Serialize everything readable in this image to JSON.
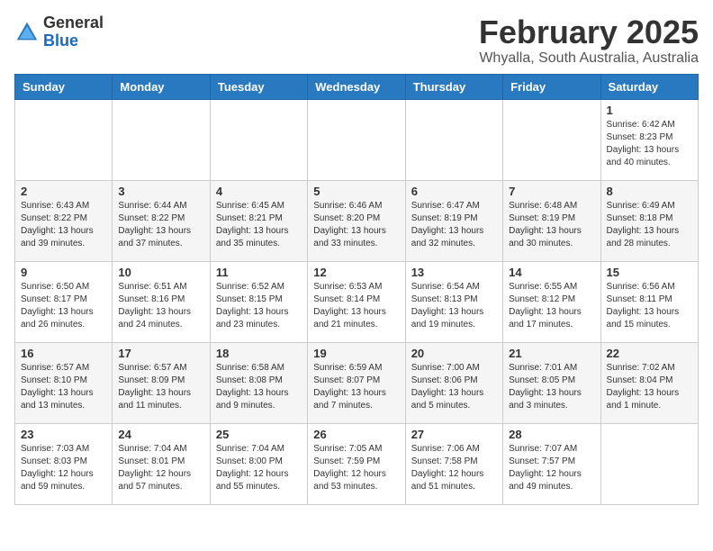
{
  "header": {
    "logo_general": "General",
    "logo_blue": "Blue",
    "month_title": "February 2025",
    "location": "Whyalla, South Australia, Australia"
  },
  "weekdays": [
    "Sunday",
    "Monday",
    "Tuesday",
    "Wednesday",
    "Thursday",
    "Friday",
    "Saturday"
  ],
  "weeks": [
    [
      {
        "day": "",
        "info": ""
      },
      {
        "day": "",
        "info": ""
      },
      {
        "day": "",
        "info": ""
      },
      {
        "day": "",
        "info": ""
      },
      {
        "day": "",
        "info": ""
      },
      {
        "day": "",
        "info": ""
      },
      {
        "day": "1",
        "info": "Sunrise: 6:42 AM\nSunset: 8:23 PM\nDaylight: 13 hours\nand 40 minutes."
      }
    ],
    [
      {
        "day": "2",
        "info": "Sunrise: 6:43 AM\nSunset: 8:22 PM\nDaylight: 13 hours\nand 39 minutes."
      },
      {
        "day": "3",
        "info": "Sunrise: 6:44 AM\nSunset: 8:22 PM\nDaylight: 13 hours\nand 37 minutes."
      },
      {
        "day": "4",
        "info": "Sunrise: 6:45 AM\nSunset: 8:21 PM\nDaylight: 13 hours\nand 35 minutes."
      },
      {
        "day": "5",
        "info": "Sunrise: 6:46 AM\nSunset: 8:20 PM\nDaylight: 13 hours\nand 33 minutes."
      },
      {
        "day": "6",
        "info": "Sunrise: 6:47 AM\nSunset: 8:19 PM\nDaylight: 13 hours\nand 32 minutes."
      },
      {
        "day": "7",
        "info": "Sunrise: 6:48 AM\nSunset: 8:19 PM\nDaylight: 13 hours\nand 30 minutes."
      },
      {
        "day": "8",
        "info": "Sunrise: 6:49 AM\nSunset: 8:18 PM\nDaylight: 13 hours\nand 28 minutes."
      }
    ],
    [
      {
        "day": "9",
        "info": "Sunrise: 6:50 AM\nSunset: 8:17 PM\nDaylight: 13 hours\nand 26 minutes."
      },
      {
        "day": "10",
        "info": "Sunrise: 6:51 AM\nSunset: 8:16 PM\nDaylight: 13 hours\nand 24 minutes."
      },
      {
        "day": "11",
        "info": "Sunrise: 6:52 AM\nSunset: 8:15 PM\nDaylight: 13 hours\nand 23 minutes."
      },
      {
        "day": "12",
        "info": "Sunrise: 6:53 AM\nSunset: 8:14 PM\nDaylight: 13 hours\nand 21 minutes."
      },
      {
        "day": "13",
        "info": "Sunrise: 6:54 AM\nSunset: 8:13 PM\nDaylight: 13 hours\nand 19 minutes."
      },
      {
        "day": "14",
        "info": "Sunrise: 6:55 AM\nSunset: 8:12 PM\nDaylight: 13 hours\nand 17 minutes."
      },
      {
        "day": "15",
        "info": "Sunrise: 6:56 AM\nSunset: 8:11 PM\nDaylight: 13 hours\nand 15 minutes."
      }
    ],
    [
      {
        "day": "16",
        "info": "Sunrise: 6:57 AM\nSunset: 8:10 PM\nDaylight: 13 hours\nand 13 minutes."
      },
      {
        "day": "17",
        "info": "Sunrise: 6:57 AM\nSunset: 8:09 PM\nDaylight: 13 hours\nand 11 minutes."
      },
      {
        "day": "18",
        "info": "Sunrise: 6:58 AM\nSunset: 8:08 PM\nDaylight: 13 hours\nand 9 minutes."
      },
      {
        "day": "19",
        "info": "Sunrise: 6:59 AM\nSunset: 8:07 PM\nDaylight: 13 hours\nand 7 minutes."
      },
      {
        "day": "20",
        "info": "Sunrise: 7:00 AM\nSunset: 8:06 PM\nDaylight: 13 hours\nand 5 minutes."
      },
      {
        "day": "21",
        "info": "Sunrise: 7:01 AM\nSunset: 8:05 PM\nDaylight: 13 hours\nand 3 minutes."
      },
      {
        "day": "22",
        "info": "Sunrise: 7:02 AM\nSunset: 8:04 PM\nDaylight: 13 hours\nand 1 minute."
      }
    ],
    [
      {
        "day": "23",
        "info": "Sunrise: 7:03 AM\nSunset: 8:03 PM\nDaylight: 12 hours\nand 59 minutes."
      },
      {
        "day": "24",
        "info": "Sunrise: 7:04 AM\nSunset: 8:01 PM\nDaylight: 12 hours\nand 57 minutes."
      },
      {
        "day": "25",
        "info": "Sunrise: 7:04 AM\nSunset: 8:00 PM\nDaylight: 12 hours\nand 55 minutes."
      },
      {
        "day": "26",
        "info": "Sunrise: 7:05 AM\nSunset: 7:59 PM\nDaylight: 12 hours\nand 53 minutes."
      },
      {
        "day": "27",
        "info": "Sunrise: 7:06 AM\nSunset: 7:58 PM\nDaylight: 12 hours\nand 51 minutes."
      },
      {
        "day": "28",
        "info": "Sunrise: 7:07 AM\nSunset: 7:57 PM\nDaylight: 12 hours\nand 49 minutes."
      },
      {
        "day": "",
        "info": ""
      }
    ]
  ]
}
